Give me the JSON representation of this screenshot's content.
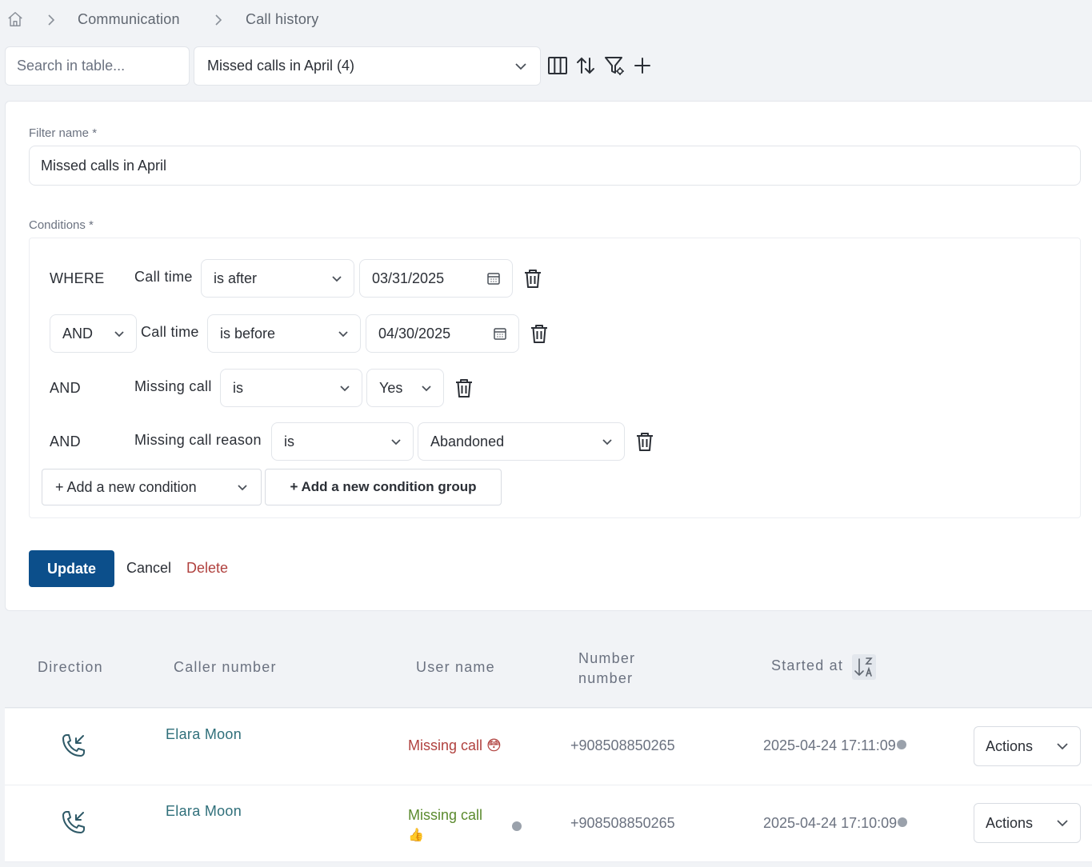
{
  "breadcrumb": {
    "items": [
      "Communication",
      "Call history"
    ],
    "home_icon": "home-icon"
  },
  "toolbar": {
    "search_placeholder": "Search in table...",
    "filter_selected": "Missed calls in April (4)",
    "icons": [
      "columns-icon",
      "sort-icon",
      "filter-settings-icon",
      "plus-icon"
    ]
  },
  "filter_form": {
    "name_label": "Filter name *",
    "name_value": "Missed calls in April",
    "conditions_label": "Conditions *",
    "conditions": [
      {
        "connector": "WHERE",
        "field": "Call time",
        "operator": "is after",
        "value": "03/31/2025",
        "value_type": "date"
      },
      {
        "connector": "AND",
        "connector_editable": true,
        "field": "Call time",
        "operator": "is before",
        "value": "04/30/2025",
        "value_type": "date"
      },
      {
        "connector": "AND",
        "field": "Missing call",
        "operator": "is",
        "value": "Yes",
        "value_type": "select"
      },
      {
        "connector": "AND",
        "field": "Missing call reason",
        "operator": "is",
        "value": "Abandoned",
        "value_type": "select"
      }
    ],
    "add_condition_label": "+ Add a new condition",
    "add_group_label": "+ Add a new condition group",
    "update_label": "Update",
    "cancel_label": "Cancel",
    "delete_label": "Delete"
  },
  "table": {
    "columns": [
      "Direction",
      "Caller number",
      "User name",
      "Number number",
      "Started at"
    ],
    "column_number_line1": "Number",
    "column_number_line2": "number",
    "sort_icon": "sort-z-a-icon",
    "rows": [
      {
        "direction_icon": "incoming-call-icon",
        "caller": "Elara Moon",
        "user_name": "Missing call",
        "user_emoji": "😳",
        "number": "+908508850265",
        "started_at": "2025-04-24 17:11:09",
        "actions_label": "Actions"
      },
      {
        "direction_icon": "incoming-call-icon",
        "caller": "Elara Moon",
        "user_name": "Missing call",
        "user_emoji": "👍",
        "number": "+908508850265",
        "started_at": "2025-04-24 17:10:09",
        "actions_label": "Actions"
      }
    ]
  },
  "colors": {
    "primary": "#0c4f8b",
    "danger": "#b0413e",
    "success_text": "#5b8a2e",
    "link_teal": "#2f6f7a",
    "background": "#f1f3f6"
  }
}
